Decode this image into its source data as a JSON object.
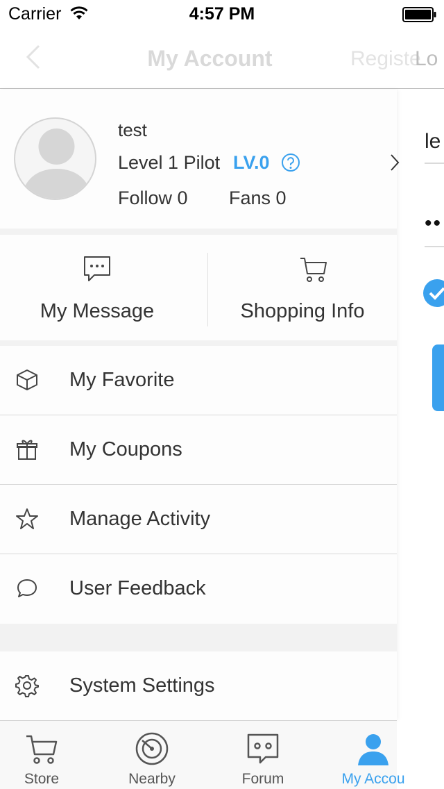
{
  "status_bar": {
    "carrier": "Carrier",
    "time": "4:57 PM"
  },
  "nav": {
    "title": "My Account",
    "register": "Registe",
    "login": "Lo"
  },
  "login_form": {
    "username_value": "le",
    "password_value": "••"
  },
  "profile": {
    "name": "test",
    "level_text": "Level 1 Pilot",
    "level_badge": "LV.0",
    "follow": "Follow 0",
    "fans": "Fans 0"
  },
  "quick_actions": [
    {
      "label": "My Message",
      "icon": "chat-bubble-icon"
    },
    {
      "label": "Shopping Info",
      "icon": "cart-icon"
    }
  ],
  "menu": [
    {
      "label": "My Favorite",
      "icon": "cube-icon"
    },
    {
      "label": "My Coupons",
      "icon": "gift-icon"
    },
    {
      "label": "Manage Activity",
      "icon": "star-icon"
    },
    {
      "label": "User Feedback",
      "icon": "speech-bubble-icon"
    }
  ],
  "settings": {
    "label": "System Settings",
    "icon": "gear-icon"
  },
  "tabs": [
    {
      "label": "Store",
      "icon": "cart-icon"
    },
    {
      "label": "Nearby",
      "icon": "radar-icon"
    },
    {
      "label": "Forum",
      "icon": "chat-box-icon"
    },
    {
      "label": "My Accou",
      "icon": "person-icon",
      "active": true
    }
  ],
  "colors": {
    "accent": "#3aa1ee",
    "text": "#333333",
    "divider": "#d8d8d8",
    "background": "#f2f2f2"
  }
}
